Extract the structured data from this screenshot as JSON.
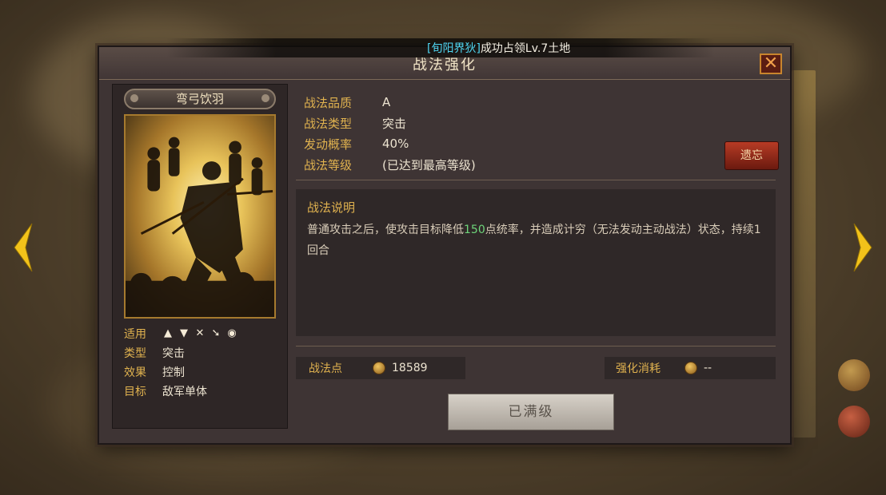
{
  "notice": {
    "tag": "[旬阳界狄]",
    "message": "成功占领Lv.7土地"
  },
  "panel": {
    "title": "战法强化",
    "close_symbol": "✕"
  },
  "card": {
    "name": "弯弓饮羽",
    "props": [
      {
        "key": "适用",
        "value": ""
      },
      {
        "key": "类型",
        "value": "突击"
      },
      {
        "key": "效果",
        "value": "控制"
      },
      {
        "key": "目标",
        "value": "敌军单体"
      }
    ],
    "troop_icons": [
      "cavalry-icon",
      "shield-icon",
      "bow-icon",
      "spear-icon",
      "siege-icon"
    ]
  },
  "info": [
    {
      "key": "战法品质",
      "value": "A"
    },
    {
      "key": "战法类型",
      "value": "突击"
    },
    {
      "key": "发动概率",
      "value": "40%"
    },
    {
      "key": "战法等级",
      "value": "(已达到最高等级)"
    }
  ],
  "forget_button": "遗忘",
  "description": {
    "title": "战法说明",
    "text_before": "普通攻击之后，使攻击目标降低",
    "highlight": "150",
    "text_after": "点统率，并造成计穷（无法发动主动战法）状态，持续1回合"
  },
  "points": {
    "label": "战法点",
    "value": "18589"
  },
  "cost": {
    "label": "强化消耗",
    "value": "--"
  },
  "maxed_button": "已满级",
  "colors": {
    "panel_bg": "#3e3434",
    "gold_label": "#e0b24f",
    "highlight_green": "#6ed57a",
    "notice_cyan": "#4fd6f2",
    "forget_red": "#b73b25"
  }
}
